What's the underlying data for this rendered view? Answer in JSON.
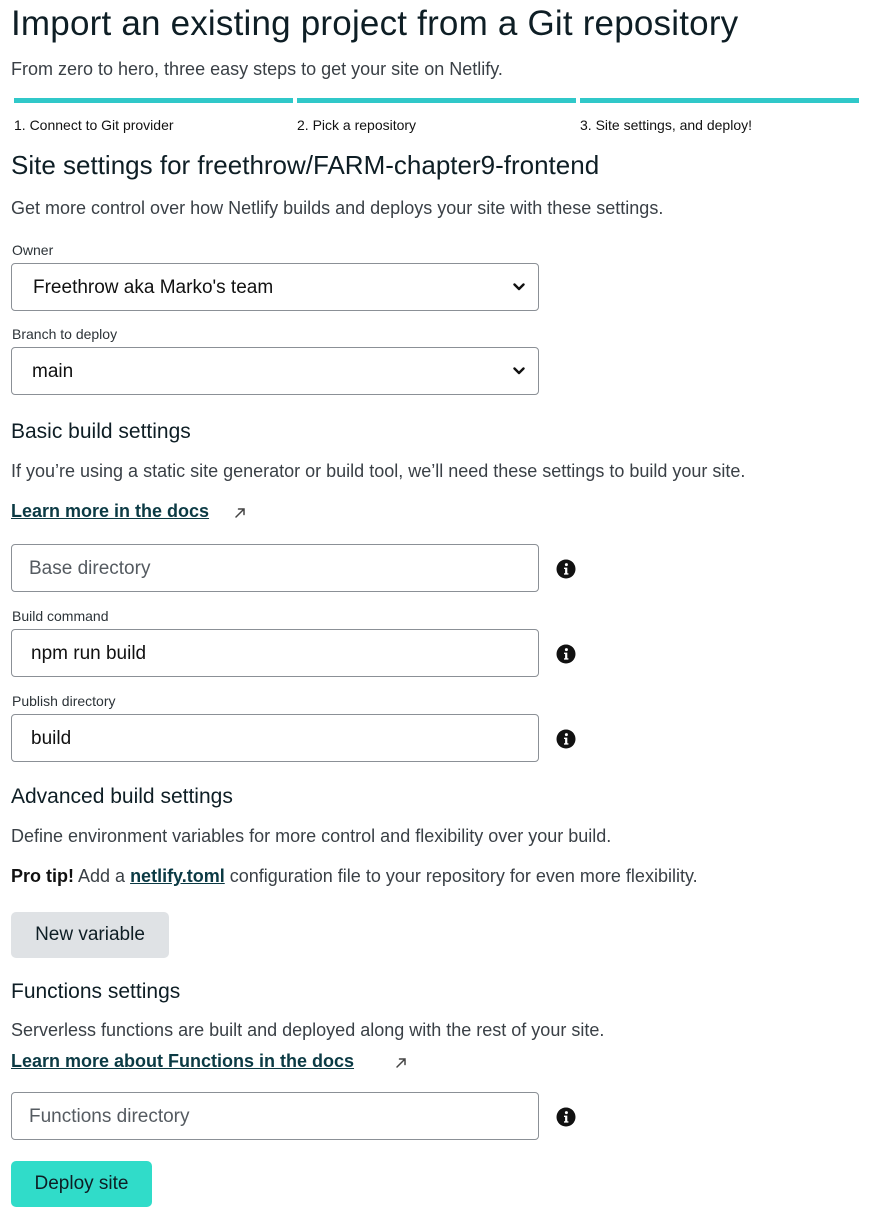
{
  "header": {
    "title": "Import an existing project from a Git repository",
    "subtitle": "From zero to hero, three easy steps to get your site on Netlify."
  },
  "steps": [
    {
      "label": "1. Connect to Git provider",
      "complete": true
    },
    {
      "label": "2. Pick a repository",
      "complete": true
    },
    {
      "label": "3. Site settings, and deploy!",
      "complete": true
    }
  ],
  "site_settings": {
    "title": "Site settings for freethrow/FARM-chapter9-frontend",
    "description": "Get more control over how Netlify builds and deploys your site with these settings.",
    "owner": {
      "label": "Owner",
      "value": "Freethrow aka Marko's team"
    },
    "branch": {
      "label": "Branch to deploy",
      "value": "main"
    }
  },
  "basic_build": {
    "title": "Basic build settings",
    "description": "If you’re using a static site generator or build tool, we’ll need these settings to build your site.",
    "docs_link": "Learn more in the docs",
    "base_directory": {
      "placeholder": "Base directory",
      "value": ""
    },
    "build_command": {
      "label": "Build command",
      "value": "npm run build"
    },
    "publish_directory": {
      "label": "Publish directory",
      "value": "build"
    }
  },
  "advanced_build": {
    "title": "Advanced build settings",
    "description": "Define environment variables for more control and flexibility over your build.",
    "tip_bold": "Pro tip!",
    "tip_pre": " Add a ",
    "tip_link": "netlify.toml",
    "tip_post": " configuration file to your repository for even more flexibility.",
    "new_variable_button": "New variable"
  },
  "functions": {
    "title": "Functions settings",
    "description": "Serverless functions are built and deployed along with the rest of your site.",
    "docs_link": "Learn more about Functions in the docs",
    "directory": {
      "placeholder": "Functions directory",
      "value": ""
    }
  },
  "deploy_button": "Deploy site",
  "colors": {
    "accent": "#30c8c9",
    "deploy_button": "#30dcc9",
    "link": "#0b3a44"
  },
  "icons": {
    "dropdown": "chevron-down-icon",
    "info": "info-icon",
    "external": "external-link-icon"
  }
}
